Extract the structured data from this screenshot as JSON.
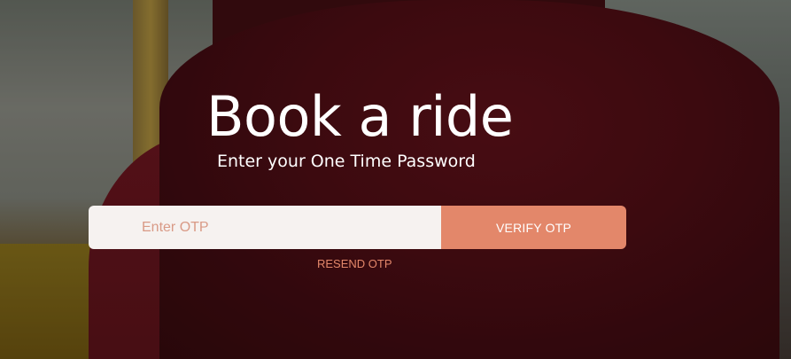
{
  "hero": {
    "title": "Book a ride",
    "subtitle": "Enter your One Time Password"
  },
  "otp_form": {
    "placeholder": "Enter OTP",
    "value": "",
    "verify_label": "VERIFY OTP"
  },
  "resend": {
    "label": "RESEND OTP"
  },
  "colors": {
    "accent": "#e3876a",
    "input_background": "#f6f2f0",
    "text_light": "#ffffff"
  }
}
